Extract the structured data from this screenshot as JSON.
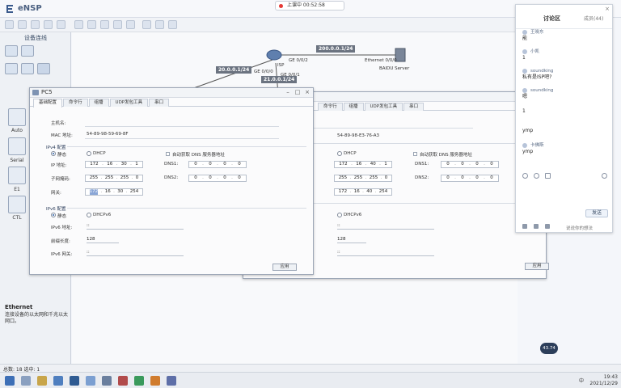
{
  "app": {
    "title": "eNSP"
  },
  "recording": {
    "label": "上课中 00:52:58"
  },
  "device_panel": {
    "title": "设备连线",
    "links": [
      "Auto",
      "Serial",
      "E1",
      "CTL"
    ]
  },
  "ethernet_info": {
    "title": "Ethernet",
    "description": "连接设备的以太网和千兆以太网口。"
  },
  "topology": {
    "isp": {
      "name": "ISP"
    },
    "server": {
      "name": "BAIDU Server"
    },
    "ports": {
      "ge000": "GE 0/0/0",
      "ge001": "GE 0/0/1",
      "ge002": "GE 0/0/2",
      "eth000": "Ethernet 0/0/0"
    },
    "ip_tags": {
      "left": "20.0.0.1/24",
      "bottom": "21.0.0.1/24",
      "right": "200.0.0.1/24"
    }
  },
  "pc_window_left": {
    "title": "PC5",
    "tabs": [
      "基础配置",
      "命令行",
      "组播",
      "UDP发包工具",
      "串口"
    ],
    "hostname_label": "主机名:",
    "mac_label": "MAC 地址:",
    "mac": "54-89-98-59-69-8F",
    "ipv4_section": "IPv4 配置",
    "static_label": "静态",
    "dhcp_label": "DHCP",
    "auto_dns_label": "自动获取 DNS 服务器地址",
    "ip_label": "IP 地址:",
    "ip": [
      "172",
      "16",
      "30",
      "1"
    ],
    "mask_label": "子网掩码:",
    "mask": [
      "255",
      "255",
      "255",
      "0"
    ],
    "gw_label": "网关:",
    "gw": [
      "172",
      "16",
      "30",
      "254"
    ],
    "dns1_label": "DNS1:",
    "dns1": [
      "0",
      "0",
      "0",
      "0"
    ],
    "dns2_label": "DNS2:",
    "dns2": [
      "0",
      "0",
      "0",
      "0"
    ],
    "ipv6_section": "IPv6 配置",
    "static6_label": "静态",
    "dhcpv6_label": "DHCPv6",
    "ipv6_addr_label": "IPv6 地址:",
    "ipv6_addr": "::",
    "prefix_label": "前缀长度:",
    "prefix": "128",
    "ipv6_gw_label": "IPv6 网关:",
    "ipv6_gw": "::",
    "apply_label": "应用"
  },
  "pc_window_right": {
    "tabs": [
      "命令行",
      "组播",
      "UDP发包工具",
      "串口"
    ],
    "mac": "54-89-98-E3-76-A3",
    "dhcp_label": "DHCP",
    "auto_dns_label": "自动获取 DNS 服务器地址",
    "ip": [
      "172",
      "16",
      "40",
      "1"
    ],
    "mask": [
      "255",
      "255",
      "255",
      "0"
    ],
    "gw": [
      "172",
      "16",
      "40",
      "254"
    ],
    "dns1_label": "DNS1:",
    "dns1": [
      "0",
      "0",
      "0",
      "0"
    ],
    "dns2_label": "DNS2:",
    "dns2": [
      "0",
      "0",
      "0",
      "0"
    ],
    "dhcpv6_label": "DHCPv6",
    "ipv6_addr": "::",
    "prefix": "128",
    "ipv6_gw": "::",
    "apply_label": "应用"
  },
  "chat": {
    "tab_discuss": "讨论区",
    "tab_viewers": "成员(44)",
    "messages": [
      {
        "user": "王晓东",
        "text": "能"
      },
      {
        "user": "小凯",
        "text": "1"
      },
      {
        "user": "soundking",
        "text": "私有是ISP吧?"
      },
      {
        "user": "soundking",
        "text": "嗯"
      },
      {
        "user": "",
        "text": "1"
      },
      {
        "user": "",
        "text": "ymp"
      },
      {
        "user": "卡佛斯",
        "text": "ymp"
      }
    ],
    "send_label": "发送",
    "input_placeholder": "说说你的想法"
  },
  "float_ball": {
    "label": "43.74"
  },
  "statusbar": {
    "text": "总数: 18 选中: 1"
  },
  "tray": {
    "time": "19:43",
    "date": "2021/12/29",
    "ime": "中"
  }
}
